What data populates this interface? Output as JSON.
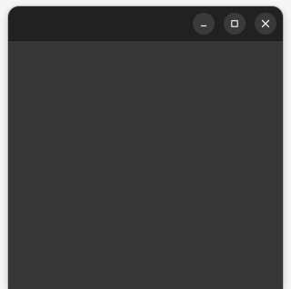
{
  "window": {
    "title": "",
    "controls": {
      "minimize_icon": "minimize-icon",
      "maximize_icon": "maximize-icon",
      "close_icon": "close-icon"
    }
  },
  "colors": {
    "titlebar": "#212121",
    "content": "#363636",
    "control_bg": "#3a3a3a",
    "control_fg": "#f0f0f0"
  }
}
